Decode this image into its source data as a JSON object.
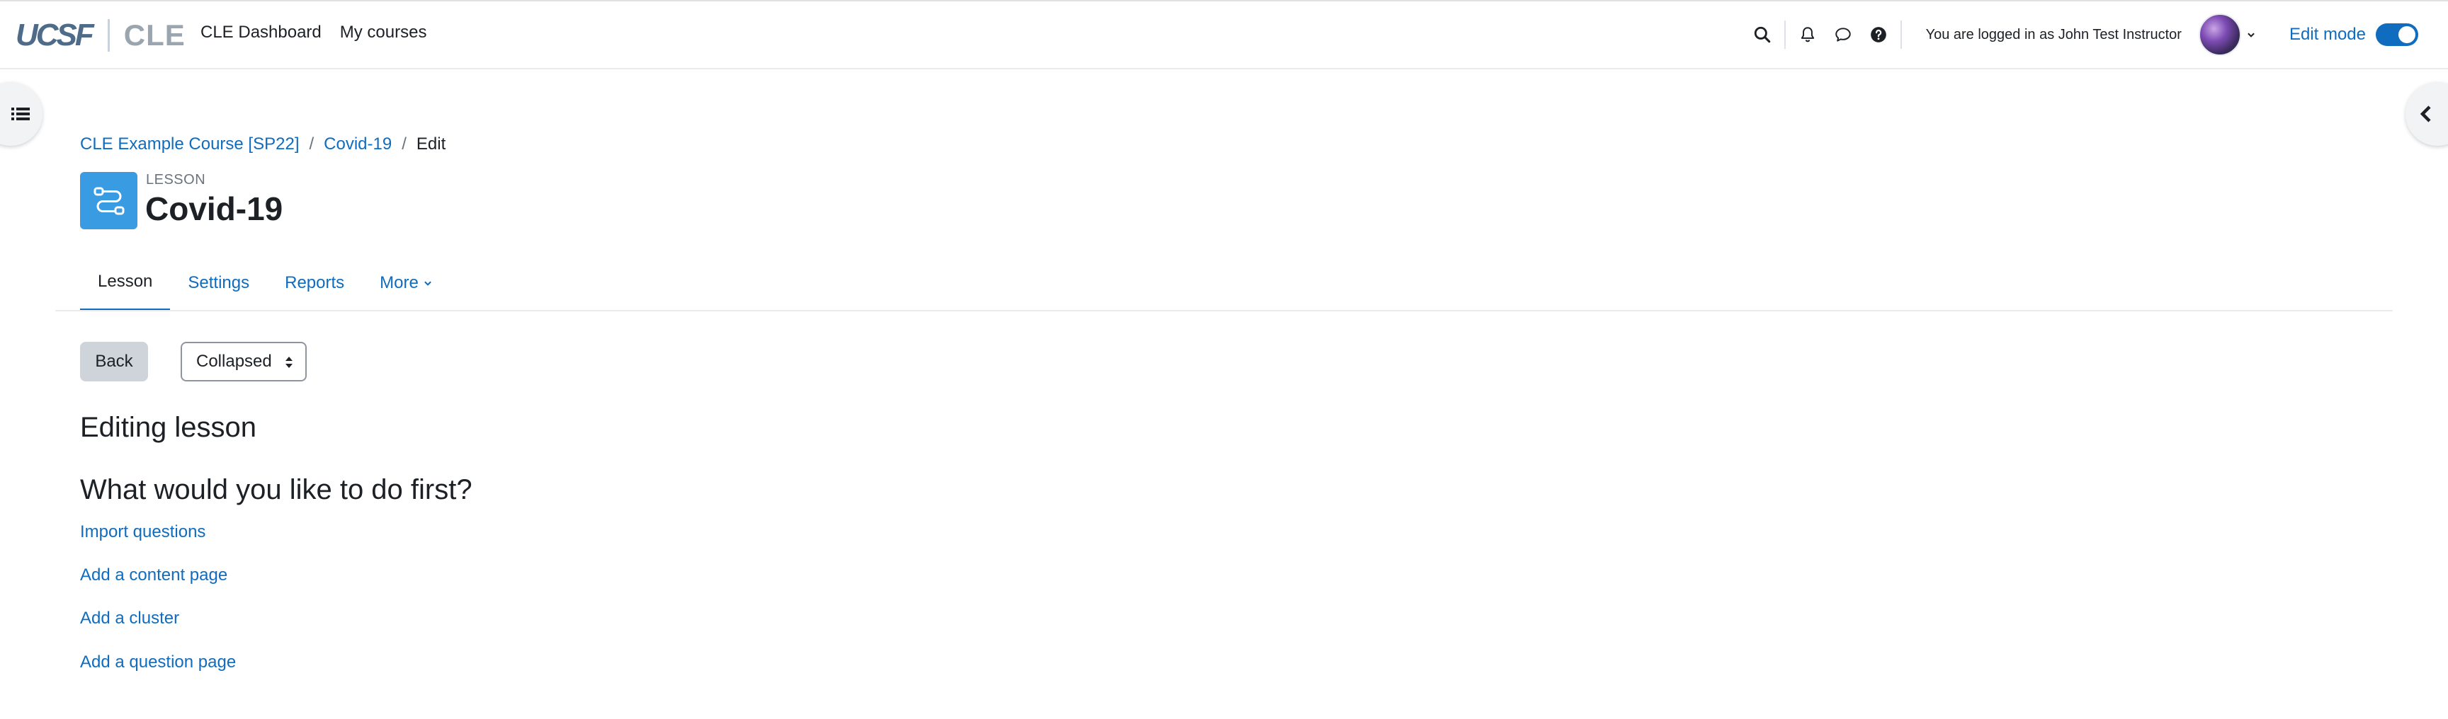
{
  "brand": {
    "logo_text": "UCSF",
    "product": "CLE"
  },
  "primary_nav": {
    "dashboard": "CLE Dashboard",
    "my_courses": "My courses"
  },
  "user_menu": {
    "login_info": "You are logged in as John Test Instructor",
    "edit_mode_label": "Edit mode",
    "edit_mode_on": true
  },
  "breadcrumb": {
    "course": "CLE Example Course [SP22]",
    "activity": "Covid-19",
    "current": "Edit",
    "separator": "/"
  },
  "header": {
    "activity_type": "LESSON",
    "title": "Covid-19"
  },
  "secondary_nav": {
    "tabs": [
      {
        "label": "Lesson",
        "active": true
      },
      {
        "label": "Settings",
        "active": false
      },
      {
        "label": "Reports",
        "active": false
      },
      {
        "label": "More",
        "active": false
      }
    ]
  },
  "controls": {
    "back_label": "Back",
    "view_select_value": "Collapsed"
  },
  "content": {
    "heading_editing": "Editing lesson",
    "heading_first": "What would you like to do first?",
    "actions": [
      "Import questions",
      "Add a content page",
      "Add a cluster",
      "Add a question page"
    ]
  },
  "colors": {
    "link": "#0f6cbf",
    "text": "#1d2125",
    "lesson_icon_bg": "#399be2",
    "back_button_bg": "#ced4da"
  },
  "icons": {
    "search": "search-icon",
    "notifications": "bell-icon",
    "messages": "chat-icon",
    "help": "question-circle-icon",
    "drawer_left": "list-icon",
    "drawer_right": "chevron-left-icon",
    "lesson": "lesson-icon"
  }
}
